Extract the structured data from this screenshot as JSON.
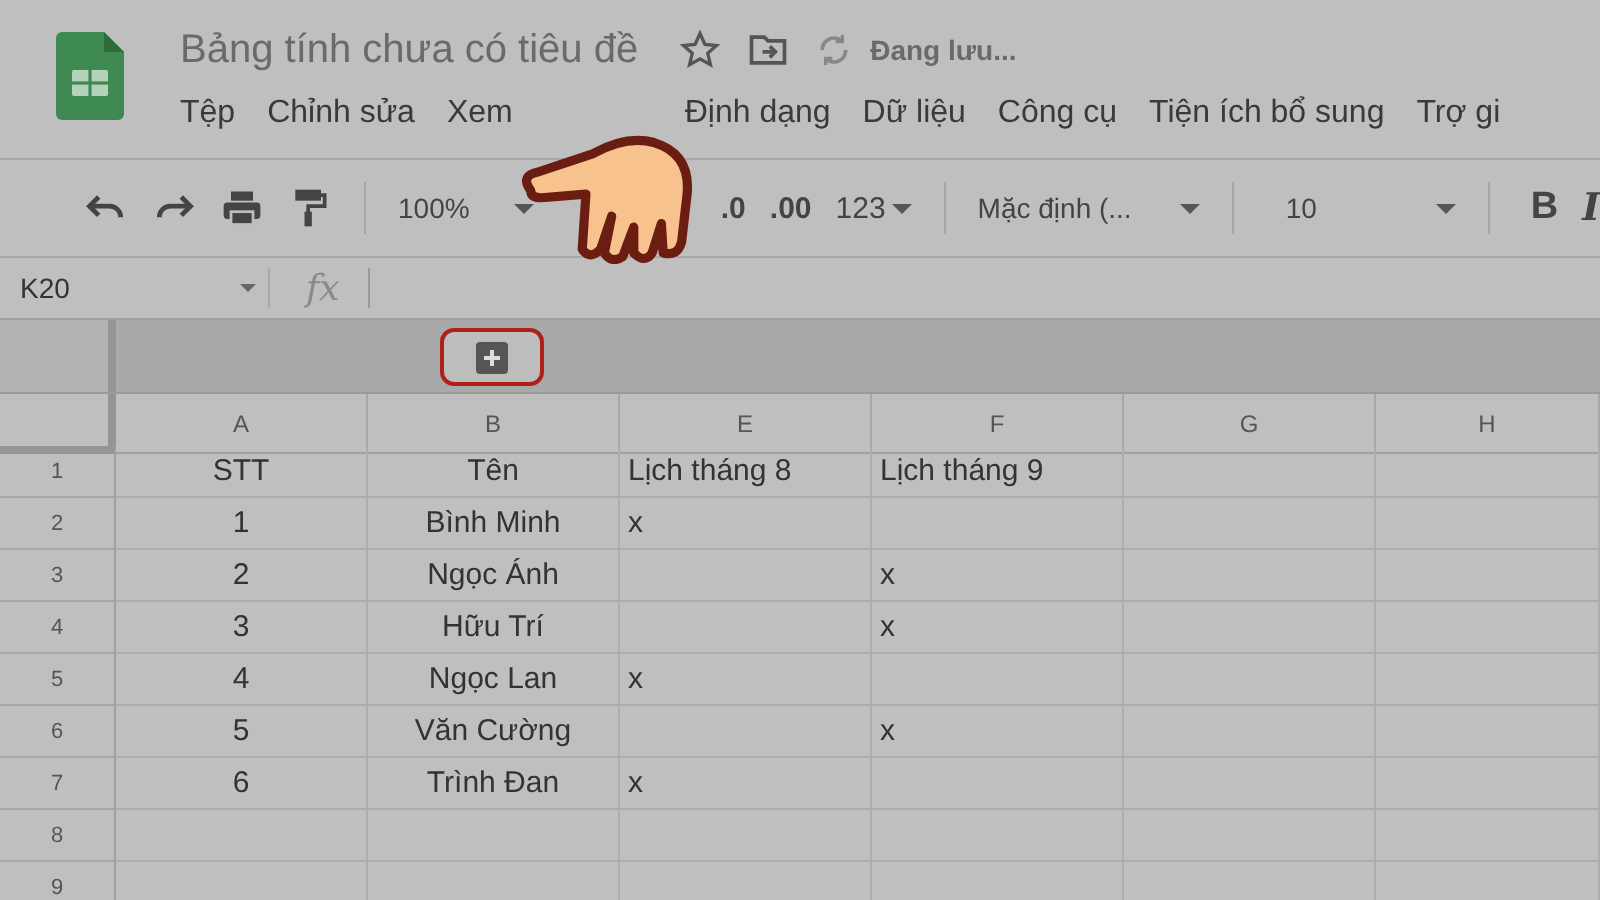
{
  "document": {
    "title": "Bảng tính chưa có tiêu đề",
    "save_status": "Đang lưu..."
  },
  "menu": [
    "Tệp",
    "Chỉnh sửa",
    "Xem",
    "Định dạng",
    "Dữ liệu",
    "Công cụ",
    "Tiện ích bổ sung",
    "Trợ gi"
  ],
  "toolbar": {
    "zoom": "100%",
    "decimal_decrease": ".0",
    "decimal_increase": ".00",
    "number_format": "123",
    "font": "Mặc định (...",
    "font_size": "10",
    "bold": "B",
    "italic": "I"
  },
  "formula_bar": {
    "cell_ref": "K20",
    "fx": "fx"
  },
  "grid": {
    "columns": [
      "A",
      "B",
      "E",
      "F",
      "G",
      "H"
    ],
    "rows": [
      {
        "number": "1",
        "cells": [
          "STT",
          "Tên",
          "Lịch tháng 8",
          "Lịch tháng 9",
          null,
          null
        ]
      },
      {
        "number": "2",
        "cells": [
          "1",
          "Bình Minh",
          "x",
          null,
          null,
          null
        ]
      },
      {
        "number": "3",
        "cells": [
          "2",
          "Ngọc Ánh",
          null,
          "x",
          null,
          null
        ]
      },
      {
        "number": "4",
        "cells": [
          "3",
          "Hữu Trí",
          null,
          "x",
          null,
          null
        ]
      },
      {
        "number": "5",
        "cells": [
          "4",
          "Ngọc Lan",
          "x",
          null,
          null,
          null
        ]
      },
      {
        "number": "6",
        "cells": [
          "5",
          "Văn Cường",
          null,
          "x",
          null,
          null
        ]
      },
      {
        "number": "7",
        "cells": [
          "6",
          "Trình Đan",
          "x",
          null,
          null,
          null
        ]
      },
      {
        "number": "8",
        "cells": []
      },
      {
        "number": "9",
        "cells": []
      }
    ]
  }
}
